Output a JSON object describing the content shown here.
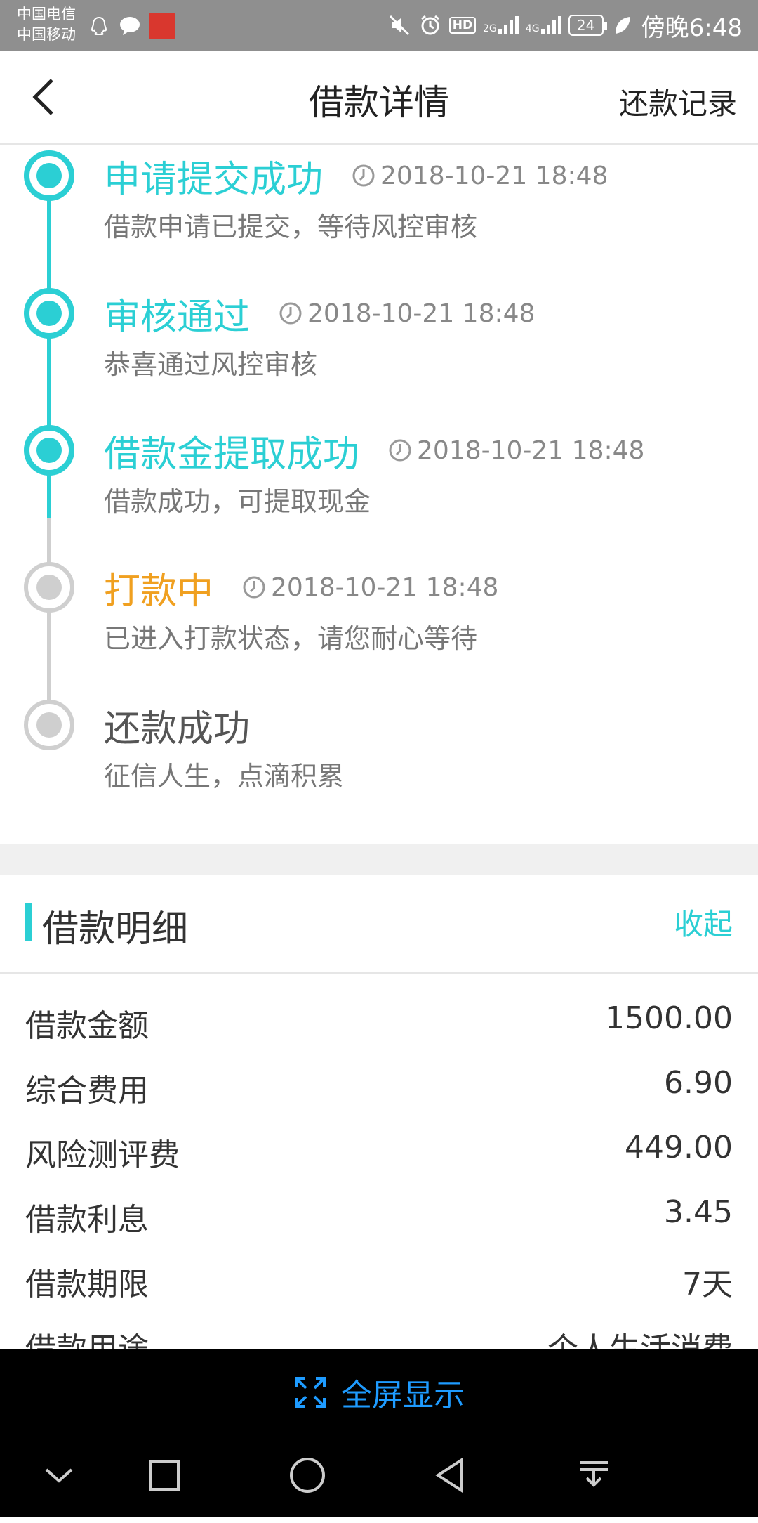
{
  "status_bar": {
    "carrier_1": "中国电信",
    "carrier_2": "中国移动",
    "network_1": "2G",
    "network_2": "4G",
    "battery": "24",
    "time": "傍晚6:48",
    "hd_label": "HD"
  },
  "header": {
    "title": "借款详情",
    "right_link": "还款记录"
  },
  "timeline": {
    "steps": [
      {
        "title": "申请提交成功",
        "time": "2018-10-21 18:48",
        "desc": "借款申请已提交，等待风控审核",
        "state": "active"
      },
      {
        "title": "审核通过",
        "time": "2018-10-21 18:48",
        "desc": "恭喜通过风控审核",
        "state": "active"
      },
      {
        "title": "借款金提取成功",
        "time": "2018-10-21 18:48",
        "desc": "借款成功，可提取现金",
        "state": "active"
      },
      {
        "title": "打款中",
        "time": "2018-10-21 18:48",
        "desc": "已进入打款状态，请您耐心等待",
        "state": "pending"
      },
      {
        "title": "还款成功",
        "time": "",
        "desc": "征信人生，点滴积累",
        "state": "todo"
      }
    ]
  },
  "details": {
    "title": "借款明细",
    "toggle": "收起",
    "rows": [
      {
        "label": "借款金额",
        "value": "1500.00"
      },
      {
        "label": "综合费用",
        "value": "6.90"
      },
      {
        "label": "风险测评费",
        "value": "449.00"
      },
      {
        "label": "借款利息",
        "value": "3.45"
      },
      {
        "label": "借款期限",
        "value": "7天"
      },
      {
        "label": "借款用途",
        "value": "个人生活消费"
      }
    ]
  },
  "fullscreen": {
    "label": "全屏显示"
  },
  "colors": {
    "accent": "#2bcfd4",
    "pending": "#f0a020",
    "link_blue": "#1e9bff"
  }
}
